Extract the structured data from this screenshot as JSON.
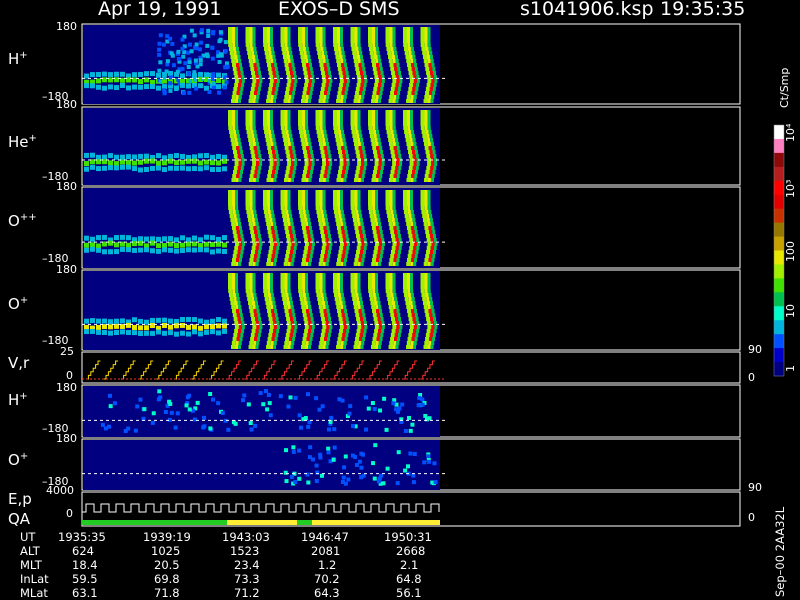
{
  "header": {
    "date": "Apr 19, 1991",
    "instrument": "EXOS–D SMS",
    "file": "s1041906.ksp",
    "time": "19:35:35"
  },
  "colorbar": {
    "unit": "Ct/Smp",
    "ticks": [
      {
        "label": "10⁴",
        "value": 10000
      },
      {
        "label": "10³",
        "value": 1000
      },
      {
        "label": "100",
        "value": 100
      },
      {
        "label": "10",
        "value": 10
      },
      {
        "label": "1",
        "value": 1
      }
    ],
    "colors": [
      "#000080",
      "#0000c8",
      "#0050ff",
      "#00b4dc",
      "#00ffc8",
      "#00c050",
      "#40e000",
      "#a0f000",
      "#e8e800",
      "#c8a000",
      "#967800",
      "#c83000",
      "#e00000",
      "#ff0000",
      "#b41e1e",
      "#8c0a0a",
      "#ff80c0",
      "#ffffff"
    ]
  },
  "chart_data": [
    {
      "type": "heatmap",
      "panel": "H+",
      "label": "H",
      "sup": "+",
      "ylabel_top": "180",
      "ylabel_bottom": "–180",
      "ylim": [
        -180,
        180
      ],
      "data_columns": [
        {
          "x": "1935:35",
          "intensity": 15,
          "width": 30
        },
        {
          "x": "1939:19",
          "intensity": 25,
          "width": 150
        },
        {
          "x": "1943:03",
          "intensity": 1500,
          "width": 180
        },
        {
          "x": "1946:47",
          "intensity": 2000,
          "width": 140
        },
        {
          "x": "1950:31",
          "intensity": 3000,
          "width": 60
        }
      ]
    },
    {
      "type": "heatmap",
      "panel": "He+",
      "label": "He",
      "sup": "+",
      "ylabel_top": "180",
      "ylabel_bottom": "–180",
      "ylim": [
        -180,
        180
      ]
    },
    {
      "type": "heatmap",
      "panel": "O++",
      "label": "O",
      "sup": "++",
      "ylabel_top": "180",
      "ylabel_bottom": "–180",
      "ylim": [
        -180,
        180
      ]
    },
    {
      "type": "heatmap",
      "panel": "O+",
      "label": "O",
      "sup": "+",
      "ylabel_top": "180",
      "ylabel_bottom": "–180",
      "ylim": [
        -180,
        180
      ]
    },
    {
      "type": "line",
      "panel": "V,r",
      "label": "V,r",
      "ylabel_top": "25",
      "ylabel_bottom": "0",
      "right_top": "90",
      "right_bottom": "0",
      "ylim": [
        0,
        25
      ]
    },
    {
      "type": "heatmap",
      "panel": "H+ (2)",
      "label": "H",
      "sup": "+",
      "ylabel_top": "180",
      "ylabel_bottom": "–180",
      "ylim": [
        -180,
        180
      ]
    },
    {
      "type": "heatmap",
      "panel": "O+ (2)",
      "label": "O",
      "sup": "+",
      "ylabel_top": "180",
      "ylabel_bottom": "–180",
      "ylim": [
        -180,
        180
      ],
      "right_top": "90",
      "right_bottom": "0"
    },
    {
      "type": "line",
      "panel": "E,p QA",
      "label": "E,p",
      "label2": "QA",
      "ylabel_top": "4000",
      "ylabel_bottom": "0",
      "right_bottom": "0",
      "ylim": [
        0,
        4000
      ]
    }
  ],
  "footer": {
    "rows": [
      {
        "name": "UT",
        "values": [
          "1935:35",
          "1939:19",
          "1943:03",
          "1946:47",
          "1950:31"
        ]
      },
      {
        "name": "ALT",
        "values": [
          "624",
          "1025",
          "1523",
          "2081",
          "2668"
        ]
      },
      {
        "name": "MLT",
        "values": [
          "18.4",
          "20.5",
          "23.4",
          "1.2",
          "2.1"
        ]
      },
      {
        "name": "InLat",
        "values": [
          "59.5",
          "69.8",
          "73.3",
          "70.2",
          "64.8"
        ]
      },
      {
        "name": "MLat",
        "values": [
          "63.1",
          "71.8",
          "71.2",
          "64.3",
          "56.1"
        ]
      }
    ],
    "side_note": "Sep–00  2AA32L"
  }
}
